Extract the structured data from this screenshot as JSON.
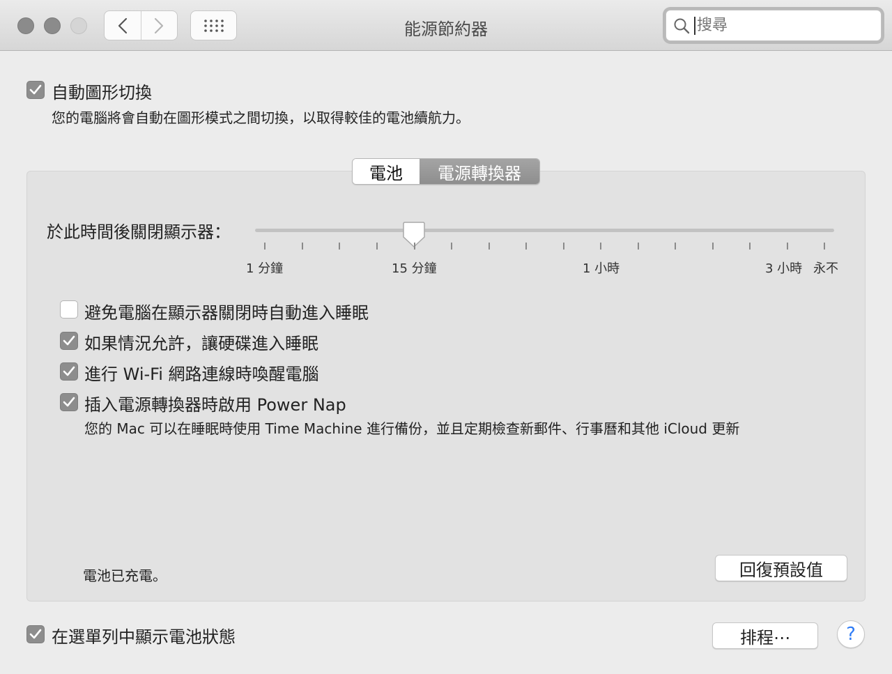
{
  "window": {
    "title": "能源節約器"
  },
  "search": {
    "placeholder": "搜尋"
  },
  "auto_graphics": {
    "label": "自動圖形切換",
    "description": "您的電腦將會自動在圖形模式之間切換，以取得較佳的電池續航力。",
    "checked": true
  },
  "tabs": [
    {
      "label": "電池",
      "selected": false
    },
    {
      "label": "電源轉換器",
      "selected": true
    }
  ],
  "display_sleep": {
    "label": "於此時間後關閉顯示器：",
    "tick_labels": [
      "1 分鐘",
      "15 分鐘",
      "1 小時",
      "3 小時",
      "永不"
    ],
    "value": "15 分鐘"
  },
  "options": [
    {
      "label": "避免電腦在顯示器關閉時自動進入睡眠",
      "checked": false
    },
    {
      "label": "如果情況允許，讓硬碟進入睡眠",
      "checked": true
    },
    {
      "label": "進行 Wi-Fi 網路連線時喚醒電腦",
      "checked": true
    },
    {
      "label": "插入電源轉換器時啟用 Power Nap",
      "checked": true
    }
  ],
  "power_nap_description": "您的 Mac 可以在睡眠時使用 Time Machine 進行備份，並且定期檢查新郵件、行事曆和其他 iCloud 更新",
  "battery_status": "電池已充電。",
  "restore_defaults_label": "回復預設值",
  "menu_bar_status": {
    "label": "在選單列中顯示電池狀態",
    "checked": true
  },
  "schedule_label": "排程⋯",
  "help_label": "?",
  "colors": {
    "accent": "#2f7cf6",
    "checkbox_on": "#8d8d8d",
    "selected_tab": "#999999"
  }
}
